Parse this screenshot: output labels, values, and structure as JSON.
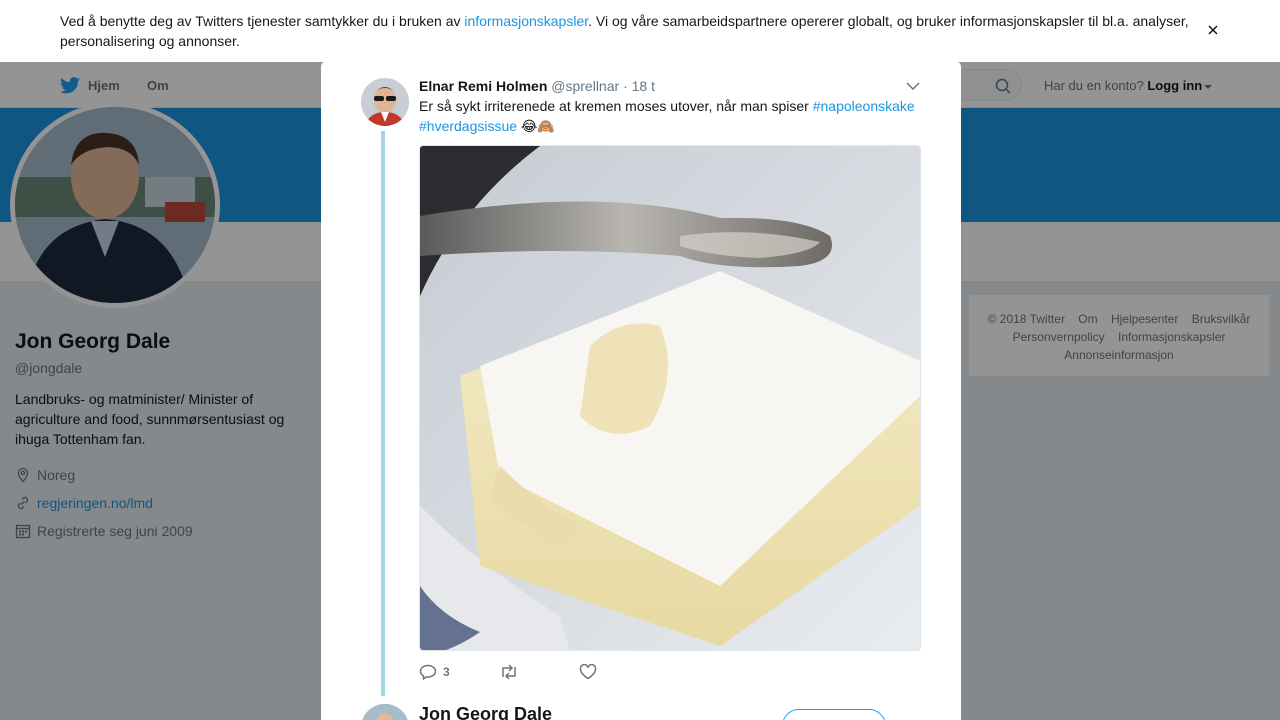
{
  "cookie_banner": {
    "text_before": "Ved å benytte deg av Twitters tjenester samtykker du i bruken av ",
    "link": "informasjonskapsler",
    "text_after": ". Vi og våre samarbeidspartnere opererer globalt, og bruker informasjonskapsler til bl.a. analyser, personalisering og annonser."
  },
  "topnav": {
    "home": "Hjem",
    "about": "Om",
    "account_question": "Har du en konto?",
    "login": "Logg inn"
  },
  "profile": {
    "name": "Jon Georg Dale",
    "handle": "@jongdale",
    "bio": "Landbruks- og matminister/ Minister of agriculture and food, sunnmørsentusiast og ihuga Tottenham fan.",
    "location": "Noreg",
    "website": "regjeringen.no/lmd",
    "joined": "Registrerte seg juni 2009"
  },
  "footer": {
    "items": [
      "© 2018 Twitter",
      "Om",
      "Hjelpesenter",
      "Bruksvilkår",
      "Personvernpolicy",
      "Informasjonskapsler",
      "Annonseinformasjon"
    ]
  },
  "tweet": {
    "fullname": "Elnar Remi Holmen",
    "username": "@sprellnar",
    "separator": "·",
    "time": "18 t",
    "text": "Er så sykt irriterenede at kremen moses utover, når man spiser ",
    "hashtag1": "#napoleonskake",
    "hashtag2": "#hverdagsissue",
    "emoji": "😂🙈",
    "reply_count": "3"
  },
  "reply": {
    "name": "Jon Georg Dale"
  },
  "colors": {
    "accent": "#1b95e0",
    "banner": "#1b95e0",
    "thread_line": "#a3d4e9"
  }
}
